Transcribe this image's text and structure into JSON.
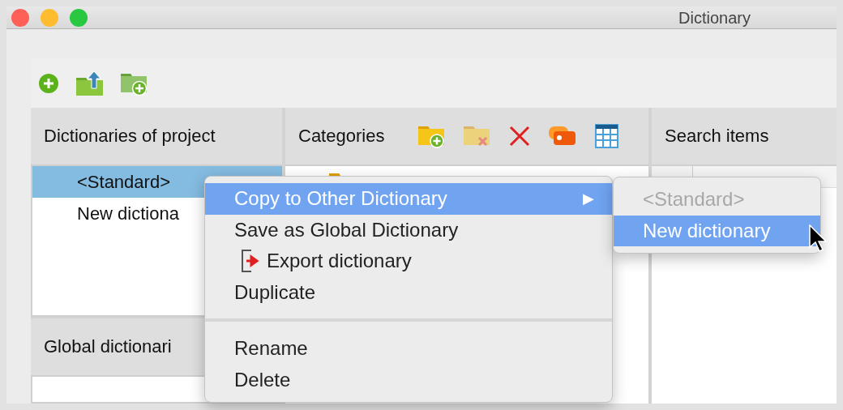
{
  "window": {
    "title": "Dictionary"
  },
  "dictionaries": {
    "header": "Dictionaries of project",
    "items": [
      {
        "label": "<Standard>",
        "selected": true
      },
      {
        "label": "New dictiona",
        "selected": false
      }
    ]
  },
  "global_dictionaries": {
    "header": "Global dictionari"
  },
  "categories": {
    "header": "Categories"
  },
  "search_items": {
    "header": "Search items"
  },
  "context_menu": {
    "items": [
      {
        "kind": "submenu",
        "label": "Copy to Other Dictionary",
        "selected": true,
        "arrow": "▶"
      },
      {
        "kind": "item",
        "label": "Save as Global Dictionary",
        "selected": false
      },
      {
        "kind": "export",
        "label": "Export dictionary",
        "selected": false
      },
      {
        "kind": "item",
        "label": "Duplicate",
        "selected": false
      },
      {
        "kind": "separator"
      },
      {
        "kind": "item",
        "label": "Rename",
        "selected": false
      },
      {
        "kind": "item",
        "label": "Delete",
        "selected": false
      }
    ]
  },
  "submenu": {
    "items": [
      {
        "label": "<Standard>",
        "disabled": true,
        "selected": false
      },
      {
        "label": "New dictionary",
        "disabled": false,
        "selected": true
      }
    ]
  }
}
